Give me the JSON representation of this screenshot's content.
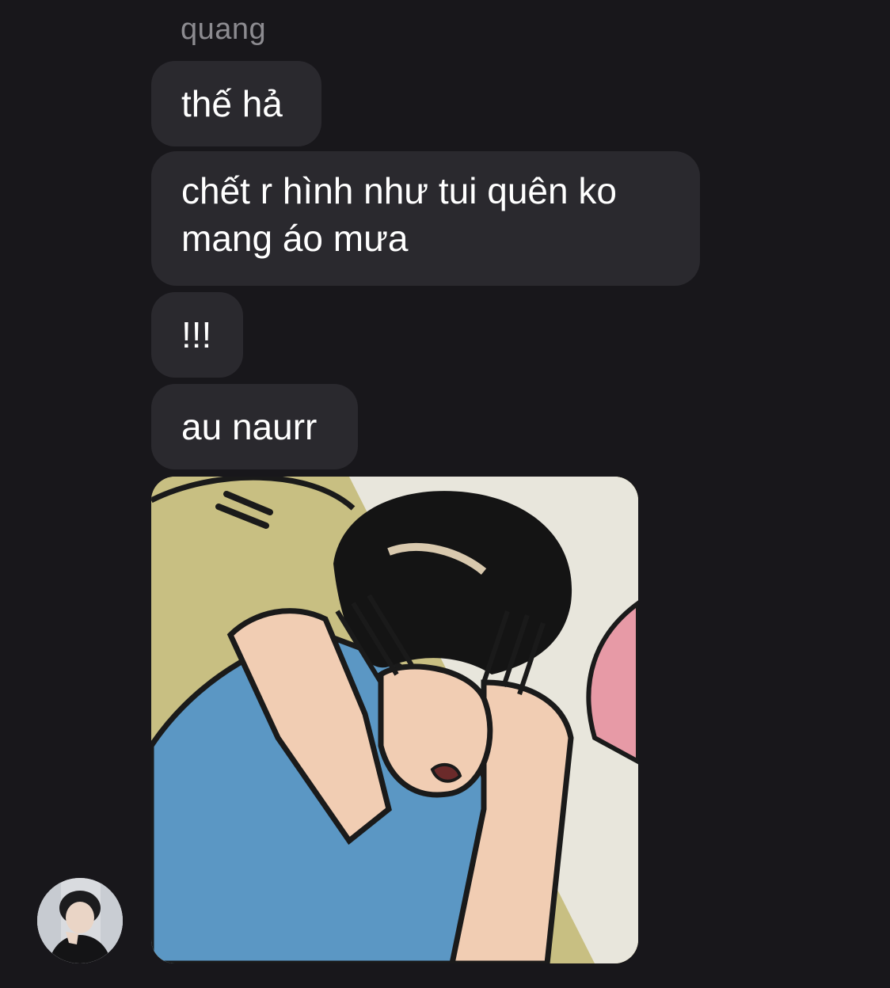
{
  "conversation": {
    "sender_name": "quang",
    "messages": [
      {
        "type": "text",
        "text": "thế hả"
      },
      {
        "type": "text",
        "text": "chết r hình như tui quên ko mang áo mưa"
      },
      {
        "type": "text",
        "text": "!!!"
      },
      {
        "type": "text",
        "text": "au naurr"
      },
      {
        "type": "image",
        "description_icon": "comic-image"
      }
    ],
    "avatar_icon": "user-avatar"
  },
  "colors": {
    "background": "#18171b",
    "bubble": "#2a292e",
    "text": "#ffffff",
    "sender_name": "#8c8b90"
  }
}
